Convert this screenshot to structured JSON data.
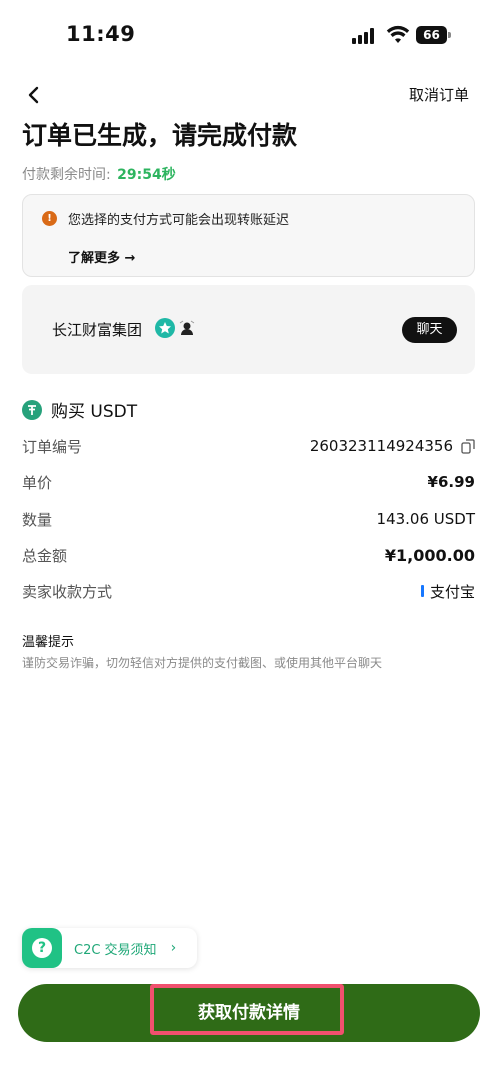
{
  "status_bar": {
    "time": "11:49",
    "battery": "66"
  },
  "header": {
    "cancel_label": "取消订单",
    "title": "订单已生成，请完成付款"
  },
  "countdown": {
    "label": "付款剩余时间:",
    "time": "29:54秒"
  },
  "warning": {
    "text": "您选择的支付方式可能会出现转账延迟",
    "learn_more": "了解更多 →"
  },
  "merchant": {
    "name": "长江财富集团",
    "chat_label": "聊天"
  },
  "order": {
    "buy_label": "购买 USDT",
    "rows": [
      {
        "label": "订单编号",
        "value": "260323114924356"
      },
      {
        "label": "单价",
        "value": "¥6.99"
      },
      {
        "label": "数量",
        "value": "143.06 USDT"
      },
      {
        "label": "总金额",
        "value": "¥1,000.00"
      },
      {
        "label": "卖家收款方式",
        "value": "支付宝"
      }
    ]
  },
  "tips": {
    "title": "温馨提示",
    "text": "谨防交易诈骗，切勿轻信对方提供的支付截图、或使用其他平台聊天"
  },
  "c2c_notice": {
    "label": "C2C 交易须知",
    "arrow": "›"
  },
  "cta": {
    "label": "获取付款详情"
  },
  "colors": {
    "accent_green": "#2db45f",
    "cta_green": "#2f6b17",
    "highlight": "#f0506e",
    "warn_orange": "#d96a17",
    "alipay_blue": "#1677ff"
  }
}
